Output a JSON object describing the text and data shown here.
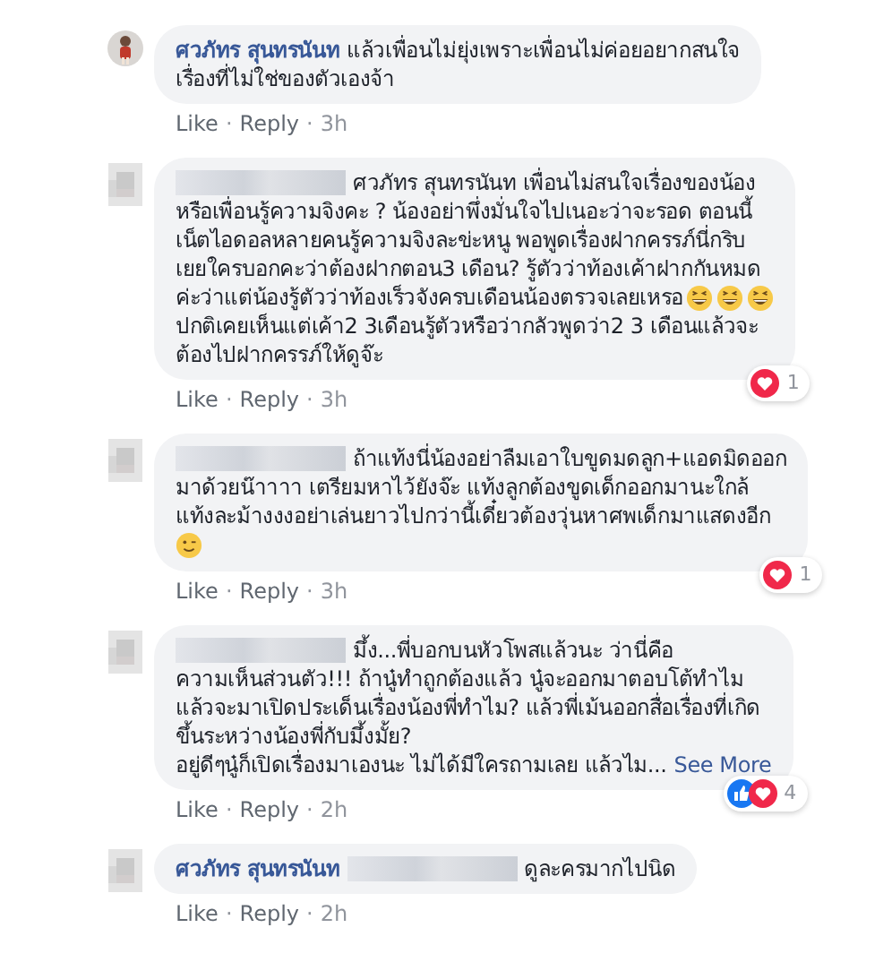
{
  "comments": [
    {
      "avatar": {
        "kind": "picture"
      },
      "lines": [
        [
          {
            "kind": "author",
            "text": "ศวภัทร สุนทรนันท"
          },
          {
            "kind": "text",
            "text": "แล้วเพื่อนไม่ยุ่งเพราะเพื่อนไม่ค่อยอยากสนใจ"
          }
        ],
        [
          {
            "kind": "text",
            "text": "เรื่องที่ไม่ใช่ของตัวเองจ้า"
          }
        ]
      ],
      "meta": {
        "like": "Like",
        "reply": "Reply",
        "time": "3h",
        "separator": "·"
      }
    },
    {
      "avatar": {
        "kind": "blurred"
      },
      "lines": [
        [
          {
            "kind": "blurred"
          },
          {
            "kind": "text",
            "text": "ศวภัทร สุนทรนันท เพื่อนไม่สนใจเรื่องของน้อง"
          }
        ],
        [
          {
            "kind": "text",
            "text": "หรือเพื่อนรู้ความจิงคะ ? น้องอย่าพึ่งมั่นใจไปเนอะว่าจะรอด ตอนนี้"
          }
        ],
        [
          {
            "kind": "text",
            "text": "เน็ตไอดอลหลายคนรู้ความจิงละข่ะหนู พอพูดเรื่องฝากครรภ์นี่กริบ"
          }
        ],
        [
          {
            "kind": "text",
            "text": "เยยใครบอกคะว่าต้องฝากตอน3 เดือน? รู้ตัวว่าท้องเค้าฝากกันหมด"
          }
        ],
        [
          {
            "kind": "text",
            "text": "ค่ะว่าแต่น้องรู้ตัวว่าท้องเร็วจังครบเดือนน้องตรวจเลยเหรอ"
          },
          {
            "kind": "laugh_emoji"
          },
          {
            "kind": "laugh_emoji"
          },
          {
            "kind": "laugh_emoji"
          }
        ],
        [
          {
            "kind": "text",
            "text": "ปกติเคยเห็นแต่เค้า2 3เดือนรู้ตัวหรือว่ากลัวพูดว่า2 3 เดือนแล้วจะ"
          }
        ],
        [
          {
            "kind": "text",
            "text": "ต้องไปฝากครรภ์ให้ดูจ๊ะ"
          }
        ]
      ],
      "meta": {
        "like": "Like",
        "reply": "Reply",
        "time": "3h",
        "separator": "·"
      },
      "reactions": [
        {
          "kind": "love"
        }
      ],
      "reaction_count": "1"
    },
    {
      "avatar": {
        "kind": "blurred"
      },
      "lines": [
        [
          {
            "kind": "blurred"
          },
          {
            "kind": "text",
            "text": "ถ้าแท้งนี่น้องอย่าลืมเอาใบขูดมดลูก+แอดมิดออก"
          }
        ],
        [
          {
            "kind": "text",
            "text": "มาด้วยน๊าาาา เตรียมหาไว้ยังจ๊ะ แท้งลูกต้องขูดเด็กออกมานะใกล้"
          }
        ],
        [
          {
            "kind": "text",
            "text": "แท้งละม้างงงอย่าเล่นยาวไปกว่านี้เดี๋ยวต้องวุ่นหาศพเด็กมาแสดงอีก"
          }
        ],
        [
          {
            "kind": "wink_emoji"
          }
        ]
      ],
      "meta": {
        "like": "Like",
        "reply": "Reply",
        "time": "3h",
        "separator": "·"
      },
      "reactions": [
        {
          "kind": "love"
        }
      ],
      "reaction_count": "1"
    },
    {
      "avatar": {
        "kind": "blurred"
      },
      "lines": [
        [
          {
            "kind": "blurred"
          },
          {
            "kind": "text",
            "text": "มึ้ง...พี่บอกบนหัวโพสแล้วนะ ว่านี่คือ"
          }
        ],
        [
          {
            "kind": "text",
            "text": "ความเห็นส่วนตัว!!! ถ้านู๋ทำถูกต้องแล้ว นู๋จะออกมาตอบโต้ทำไม"
          }
        ],
        [
          {
            "kind": "text",
            "text": "แล้วจะมาเปิดประเด็นเรื่องน้องพี่ทำไม? แล้วพี่เม้นออกสื่อเรื่องที่เกิด"
          }
        ],
        [
          {
            "kind": "text",
            "text": "ขึ้นระหว่างน้องพี่กับมึ้งมั้ย?"
          }
        ],
        [
          {
            "kind": "text",
            "text": "อยู่ดีๆนู๋ก็เปิดเรื่องมาเองนะ ไม่ได้มีใครถามเลย แล้วไม..."
          },
          {
            "kind": "link",
            "text": "See More"
          }
        ]
      ],
      "meta": {
        "like": "Like",
        "reply": "Reply",
        "time": "2h",
        "separator": "·"
      },
      "reactions": [
        {
          "kind": "like"
        },
        {
          "kind": "love"
        }
      ],
      "reaction_count": "4"
    },
    {
      "avatar": {
        "kind": "blurred"
      },
      "lines": [
        [
          {
            "kind": "author",
            "text": "ศวภัทร สุนทรนันท"
          },
          {
            "kind": "blurred"
          },
          {
            "kind": "text",
            "text": "ดูละครมากไปนิด"
          }
        ]
      ],
      "meta": {
        "like": "Like",
        "reply": "Reply",
        "time": "2h",
        "separator": "·"
      }
    }
  ]
}
